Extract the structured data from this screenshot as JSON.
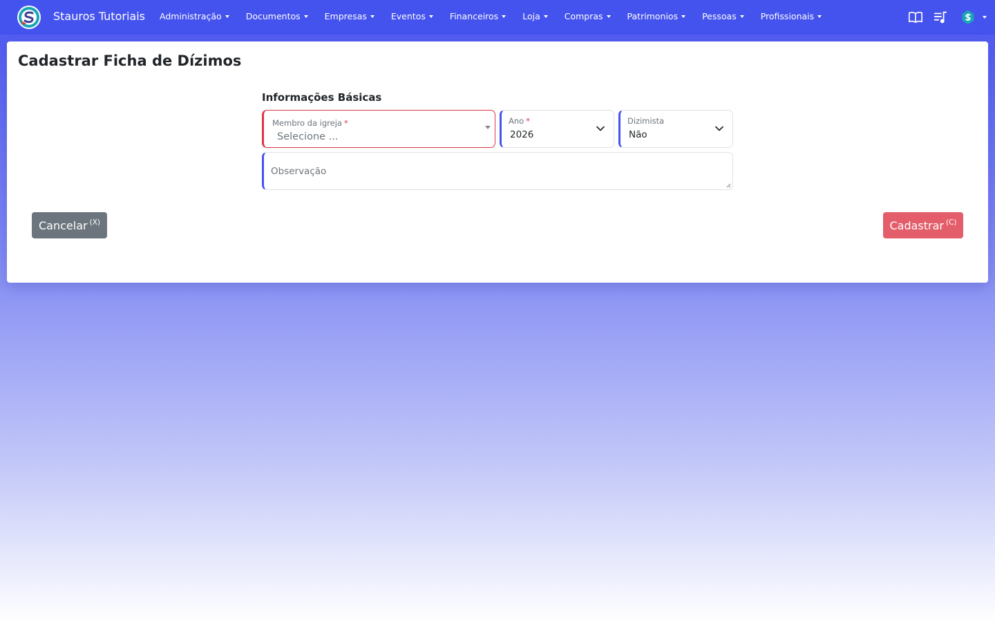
{
  "navbar": {
    "brand": "Stauros Tutoriais",
    "menu": [
      {
        "label": "Administração"
      },
      {
        "label": "Documentos"
      },
      {
        "label": "Empresas"
      },
      {
        "label": "Eventos"
      },
      {
        "label": "Financeiros"
      },
      {
        "label": "Loja"
      },
      {
        "label": "Compras"
      },
      {
        "label": "Patrimonios"
      },
      {
        "label": "Pessoas"
      },
      {
        "label": "Profissionais"
      }
    ],
    "icons": [
      "book-icon",
      "playlist-icon",
      "user-avatar-icon"
    ]
  },
  "page": {
    "title": "Cadastrar Ficha de Dízimos",
    "section_title": "Informações Básicas"
  },
  "form": {
    "membro": {
      "label": "Membro da igreja",
      "required_mark": "*",
      "placeholder": "Selecione ..."
    },
    "ano": {
      "label": "Ano",
      "required_mark": "*",
      "value": "2026"
    },
    "dizimista": {
      "label": "Dizimista",
      "value": "Não"
    },
    "observacao": {
      "placeholder": "Observação"
    }
  },
  "buttons": {
    "cancel": {
      "label": "Cancelar",
      "shortcut": "(X)"
    },
    "submit": {
      "label": "Cadastrar",
      "shortcut": "(C)"
    }
  },
  "colors": {
    "navbar": "#4553ee",
    "accent": "#4553ee",
    "danger": "#dc3545",
    "submit": "#e35d6a",
    "cancel": "#6c757d"
  }
}
